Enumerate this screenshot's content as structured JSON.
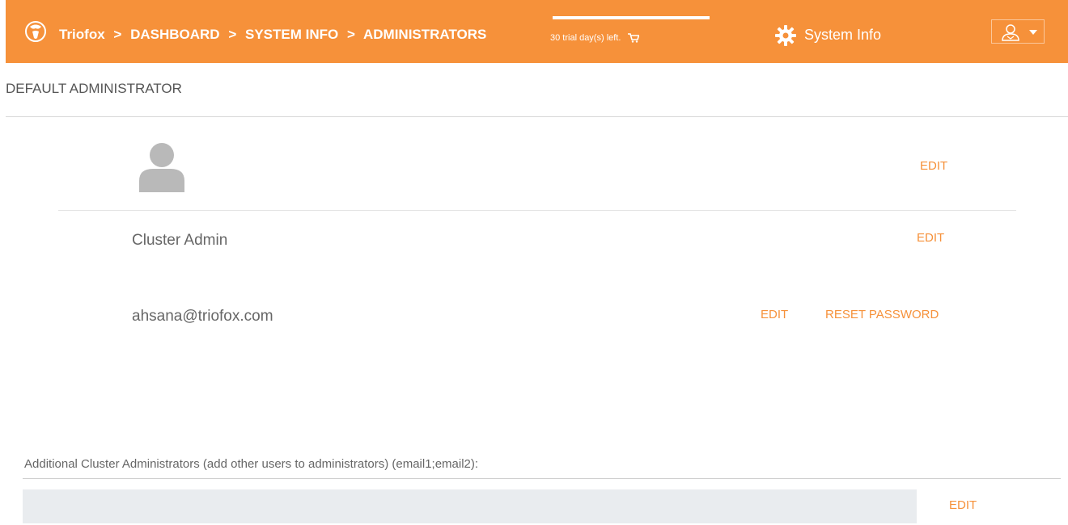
{
  "header": {
    "brand": "Triofox",
    "breadcrumbs": [
      "DASHBOARD",
      "SYSTEM INFO",
      "ADMINISTRATORS"
    ],
    "separator": ">",
    "trial_text": "30 trial day(s) left.",
    "system_info_label": "System Info",
    "icons": [
      "triofox-logo-icon",
      "cart-icon",
      "gear-icon",
      "user-icon",
      "caret-down-icon"
    ]
  },
  "default_admin": {
    "section_title": "DEFAULT ADMINISTRATOR",
    "avatar_edit_label": "EDIT",
    "name": "Cluster Admin",
    "name_edit_label": "EDIT",
    "email": "ahsana@triofox.com",
    "email_edit_label": "EDIT",
    "reset_password_label": "RESET PASSWORD"
  },
  "additional_admins": {
    "label": "Additional Cluster Administrators (add other users to administrators) (email1;email2):",
    "value": "",
    "placeholder": "",
    "edit_label": "EDIT"
  },
  "colors": {
    "accent": "#f6913a",
    "text": "#555555",
    "input_bg": "#e9ecef"
  }
}
